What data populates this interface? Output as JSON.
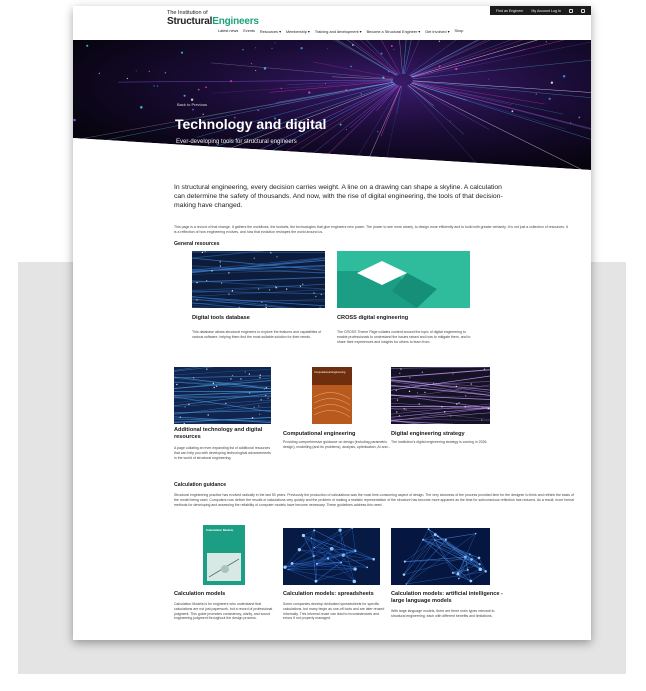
{
  "logo": {
    "small": "The Institution of",
    "big_a": "Structural",
    "big_b": "Engineers"
  },
  "utility": {
    "find_engineer": "Find an Engineer",
    "account": "My Account Log In"
  },
  "nav": [
    "Latest news",
    "Events",
    "Resources ▾",
    "Membership ▾",
    "Training and development ▾",
    "Become a Structural Engineer ▾",
    "Get Involved ▾",
    "Shop"
  ],
  "hero": {
    "back": "Back to Previous",
    "title": "Technology and digital",
    "subtitle": "Ever-developing tools for structural engineers"
  },
  "intro": {
    "lead": "In structural engineering, every decision carries weight. A line on a drawing can shape a skyline. A calculation can determine the safety of thousands. And now, with the rise of digital engineering, the tools of that decision-making have changed.",
    "body": "This page is a record of that change. It gathers the workflows, the toolsets, the technologies that give engineers new power. The power to see more clearly, to design more efficiently and to build with greater certainty. It is not just a collection of resources. It is a reflection of how engineering evolves, and how that evolution reshapes the world around us."
  },
  "sections": {
    "general": "General resources",
    "calc": "Calculation guidance"
  },
  "general_cards": [
    {
      "title": "Digital tools database",
      "desc": "This database allows structural engineers to explore the features and capabilities of various software, helping them find the most suitable solution for their needs."
    },
    {
      "title": "CROSS digital engineering",
      "desc": "The CROSS Theme Page collates content around the topic of digital engineering to enable professionals to understand the issues raised and how to mitigate them, and to share their experiences and insights for others to learn from."
    },
    {
      "title": "Additional technology and digital resources",
      "desc": "A page collating an ever-expanding list of additional resources that can help you with developing technological advancements in the world of structural engineering."
    },
    {
      "title": "Computational engineering",
      "desc": "Providing comprehensive guidance on design (including parametric design), modelling (and its problems), analysis, optimisation, AI and..."
    },
    {
      "title": "Digital engineering strategy",
      "desc": "The Institution's digital engineering strategy is coming in 2026."
    }
  ],
  "calc_paragraph": "Structural engineering practice has evolved radically in the last 50 years. Previously the production of calculations was the most time-consuming aspect of design. The very slowness of the process provided time for the designer to think and rethink the basis of the model being used. Computers now deliver the results of calculations very quickly and the problem of making a realistic representation of the structure has become more apparent as the time for subconscious reflection has reduced. As a result, more formal methods for developing and assessing the reliability of computer models have become necessary. These guidelines address this need.",
  "calc_cards": [
    {
      "title": "Calculation models",
      "desc": "Calculation Models is for engineers who understand that calculations are not just paperwork, but a record of professional judgment. This guide promotes consistency, clarity, and sound engineering judgment throughout the design process."
    },
    {
      "title": "Calculation models: spreadsheets",
      "desc": "Some companies develop dedicated spreadsheets for specific calculations, but many begin as one-off tools and are later reused informally. This informal reuse can lead to inconsistencies and errors if not properly managed."
    },
    {
      "title": "Calculation models: artificial intelligence - large language models",
      "desc": "With large language models, there are three main types relevant to structural engineering, each with different benefits and limitations."
    }
  ],
  "book_cover": {
    "calc_title": "Calculation Models",
    "comp_title": "Computational Engineering"
  },
  "colors": {
    "accent": "#1aa37a",
    "hero_bg": "#140a2a",
    "panel_bg": "#e4e4e4"
  }
}
